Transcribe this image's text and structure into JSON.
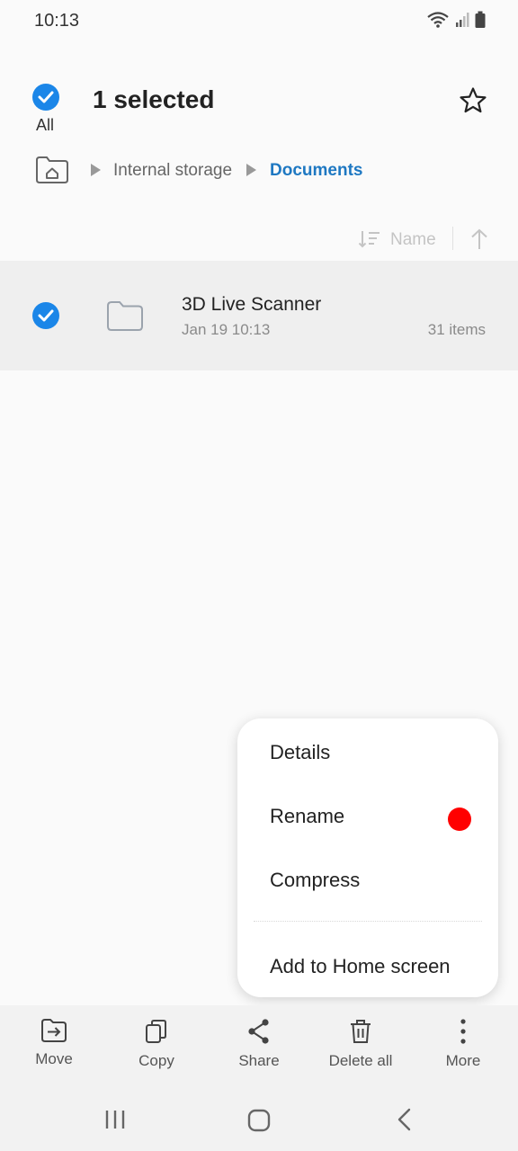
{
  "status_bar": {
    "time": "10:13",
    "icons": [
      "wifi-icon",
      "signal-icon",
      "battery-icon"
    ]
  },
  "header": {
    "select_all_label": "All",
    "title": "1 selected",
    "favorite_icon": "star-icon"
  },
  "breadcrumb": {
    "home_icon": "home-folder-icon",
    "items": [
      {
        "label": "Internal storage",
        "active": false
      },
      {
        "label": "Documents",
        "active": true
      }
    ]
  },
  "sort": {
    "label": "Name",
    "direction_icon": "arrow-up-icon"
  },
  "files": [
    {
      "name": "3D Live Scanner",
      "date": "Jan 19 10:13",
      "count": "31 items",
      "selected": true,
      "type": "folder"
    }
  ],
  "context_menu": {
    "items": [
      {
        "label": "Details"
      },
      {
        "label": "Rename"
      },
      {
        "label": "Compress"
      },
      {
        "label": "Add to Home screen"
      }
    ]
  },
  "action_bar": {
    "items": [
      {
        "label": "Move",
        "icon": "move-icon"
      },
      {
        "label": "Copy",
        "icon": "copy-icon"
      },
      {
        "label": "Share",
        "icon": "share-icon"
      },
      {
        "label": "Delete all",
        "icon": "trash-icon"
      },
      {
        "label": "More",
        "icon": "more-vertical-icon"
      }
    ]
  },
  "nav_bar": {
    "icons": [
      "recents-icon",
      "home-icon",
      "back-icon"
    ]
  },
  "colors": {
    "accent": "#1b86e8",
    "breadcrumb_active": "#1e78c2",
    "selected_row_bg": "#efefef",
    "marker": "#ff0000"
  }
}
